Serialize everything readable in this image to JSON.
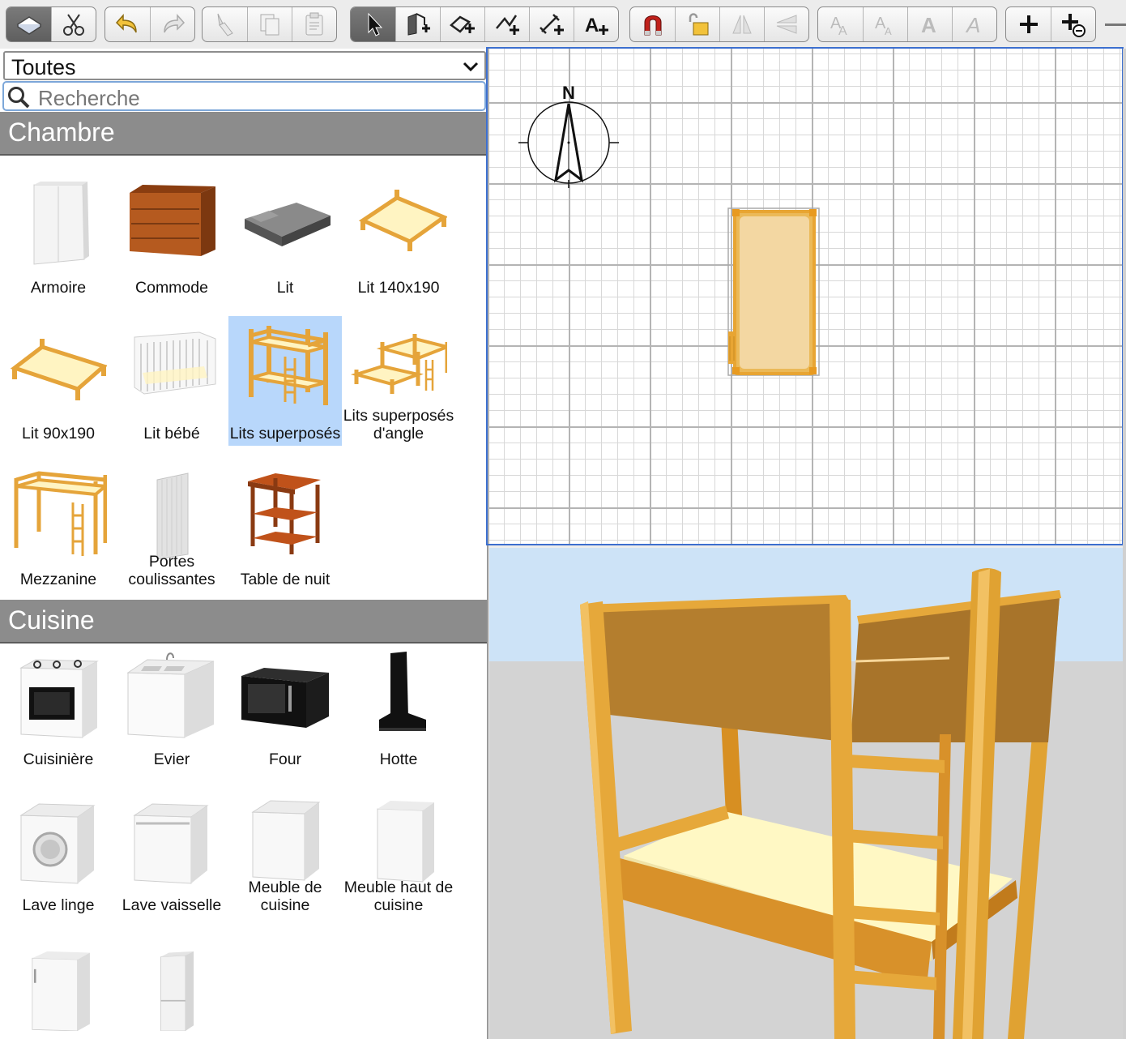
{
  "toolbar": {
    "groups": [
      {
        "buttons": [
          {
            "icon": "plan-mode-icon",
            "active": true
          },
          {
            "icon": "cut-icon"
          }
        ]
      },
      {
        "buttons": [
          {
            "icon": "undo-icon"
          },
          {
            "icon": "redo-icon"
          }
        ]
      },
      {
        "buttons": [
          {
            "icon": "paint-brush-icon"
          },
          {
            "icon": "copy-icon"
          },
          {
            "icon": "paste-icon"
          }
        ]
      },
      {
        "buttons": [
          {
            "icon": "select-pointer-icon",
            "active": true
          },
          {
            "icon": "create-walls-icon"
          },
          {
            "icon": "create-rooms-icon"
          },
          {
            "icon": "create-polylines-icon"
          },
          {
            "icon": "create-dimensions-icon"
          },
          {
            "icon": "add-text-icon"
          }
        ]
      },
      {
        "buttons": [
          {
            "icon": "magnetism-icon"
          },
          {
            "icon": "lock-icon"
          },
          {
            "icon": "flip-horizontal-icon"
          },
          {
            "icon": "flip-vertical-icon"
          }
        ]
      },
      {
        "buttons": [
          {
            "icon": "increase-text-size-icon"
          },
          {
            "icon": "decrease-text-size-icon"
          },
          {
            "icon": "bold-text-icon"
          },
          {
            "icon": "italic-text-icon"
          }
        ]
      },
      {
        "buttons": [
          {
            "icon": "zoom-in-icon"
          },
          {
            "icon": "add-furniture-icon"
          }
        ]
      }
    ]
  },
  "catalog": {
    "category_selected": "Toutes",
    "search_placeholder": "Recherche",
    "sections": [
      {
        "title": "Chambre",
        "items": [
          {
            "label": "Armoire",
            "icon": "wardrobe-icon"
          },
          {
            "label": "Commode",
            "icon": "dresser-icon"
          },
          {
            "label": "Lit",
            "icon": "bed-icon"
          },
          {
            "label": "Lit 140x190",
            "icon": "double-bed-icon"
          },
          {
            "label": "Lit 90x190",
            "icon": "single-bed-icon"
          },
          {
            "label": "Lit bébé",
            "icon": "crib-icon"
          },
          {
            "label": "Lits superposés",
            "icon": "bunk-bed-icon",
            "selected": true
          },
          {
            "label": "Lits superposés d'angle",
            "icon": "corner-bunk-bed-icon"
          },
          {
            "label": "Mezzanine",
            "icon": "loft-bed-icon"
          },
          {
            "label": "Portes coulissantes",
            "icon": "sliding-doors-icon"
          },
          {
            "label": "Table de nuit",
            "icon": "nightstand-icon"
          }
        ]
      },
      {
        "title": "Cuisine",
        "items": [
          {
            "label": "Cuisinière",
            "icon": "cooker-icon"
          },
          {
            "label": "Evier",
            "icon": "sink-icon"
          },
          {
            "label": "Four",
            "icon": "microwave-oven-icon"
          },
          {
            "label": "Hotte",
            "icon": "range-hood-icon"
          },
          {
            "label": "Lave linge",
            "icon": "washing-machine-icon"
          },
          {
            "label": "Lave vaisselle",
            "icon": "dishwasher-icon"
          },
          {
            "label": "Meuble de cuisine",
            "icon": "kitchen-cabinet-icon"
          },
          {
            "label": "Meuble haut de cuisine",
            "icon": "kitchen-upper-cabinet-icon"
          },
          {
            "label": "",
            "icon": "fridge-icon"
          },
          {
            "label": "",
            "icon": "fridge-freezer-icon"
          }
        ]
      }
    ]
  },
  "plan": {
    "compass_label": "N"
  },
  "colors": {
    "accent": "#3c6fcf",
    "selection": "#b8d7fb",
    "section_header": "#8c8c8c",
    "bed_wood": "#eaa43a",
    "mattress": "#fff8c4",
    "sky": "#cde3f7",
    "ground": "#d3d3d3"
  }
}
